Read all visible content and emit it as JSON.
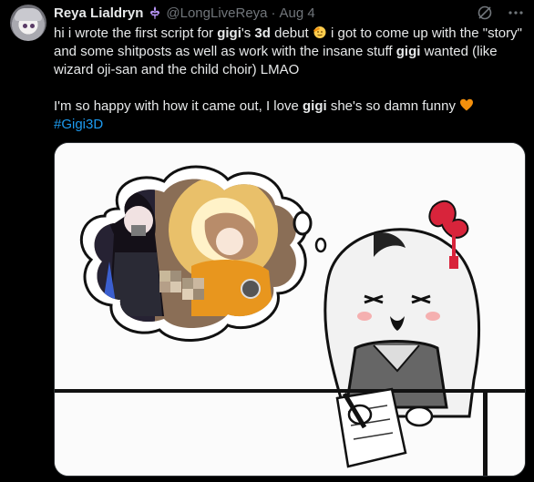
{
  "tweet": {
    "author_name": "Reya Lialdryn",
    "handle": "@LongLiveReya",
    "separator": "·",
    "date": "Aug 4",
    "line1_a": "hi i wrote the first script for ",
    "line1_b": "gigi",
    "line1_c": "'s ",
    "line1_d": "3d",
    "line1_e": " debut ",
    "line1_f": " i got to come up with the \"story\" and some shitposts as well as work with the insane stuff ",
    "line1_g": "gigi",
    "line1_h": " wanted (like wizard oji-san and the child choir) LMAO",
    "line2_a": "I'm so happy with how it came out, I love ",
    "line2_b": "gigi",
    "line2_c": " she's so damn funny ",
    "hashtag": "#Gigi3D"
  },
  "icons": {
    "verified_badge": "fleur-de-lis-badge-icon",
    "grok": "grok-icon",
    "more": "more-icon",
    "emoji1": "saluting-face-emoji",
    "emoji2": "orange-heart-emoji"
  },
  "colors": {
    "background": "#000000",
    "text": "#e7e9ea",
    "secondary": "#71767b",
    "link": "#1d9bf0",
    "badge": "#a78bfa"
  }
}
